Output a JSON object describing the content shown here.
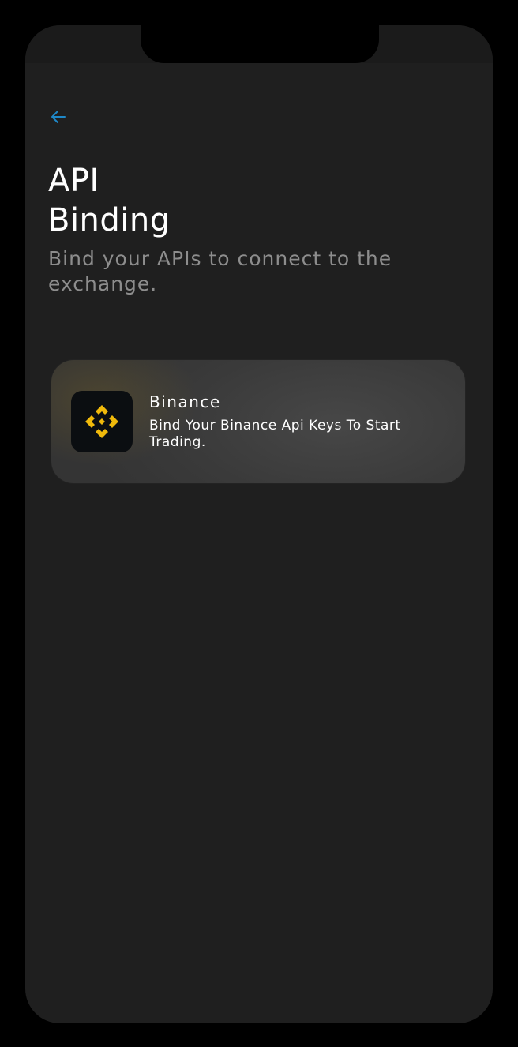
{
  "header": {
    "back_icon": "arrow-left-icon",
    "accent_color": "#1e88c8"
  },
  "page": {
    "title": "API\nBinding",
    "subtitle": "Bind your APIs to connect to the exchange."
  },
  "exchanges": [
    {
      "name": "Binance",
      "description": "Bind Your Binance Api Keys To Start Trading.",
      "logo_icon": "binance-logo-icon",
      "logo_color": "#f0b90b"
    }
  ]
}
